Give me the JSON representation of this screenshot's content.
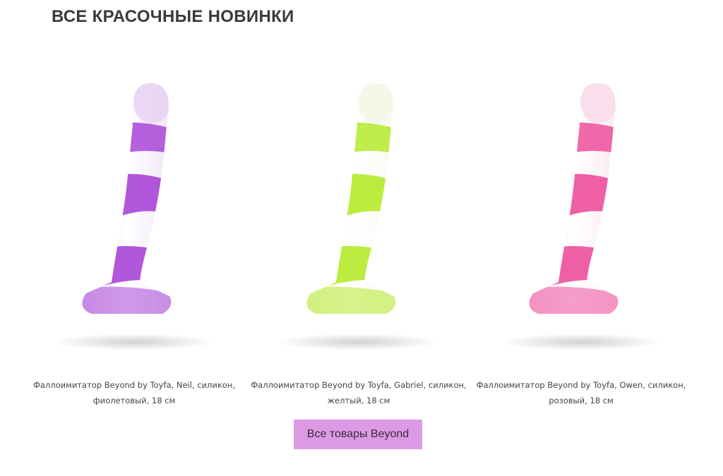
{
  "section": {
    "heading": "ВСЕ КРАСОЧНЫЕ НОВИНКИ"
  },
  "products": [
    {
      "name": "Фаллоимитатор Beyond by Toyfa, Neil, силикон, фиолетовый, 18 см",
      "color_main": "#a845d6",
      "color_light": "#e9d4f3"
    },
    {
      "name": "Фаллоимитатор Beyond by Toyfa, Gabriel, силикон, желтый, 18 см",
      "color_main": "#b4ea2a",
      "color_light": "#f2f7e6"
    },
    {
      "name": "Фаллоимитатор Beyond by Toyfa, Owen, силикон, розовый, 18 см",
      "color_main": "#ec4f9c",
      "color_light": "#f8dcea"
    }
  ],
  "cta": {
    "label": "Все товары Beyond",
    "color": "#dd9ae4"
  }
}
